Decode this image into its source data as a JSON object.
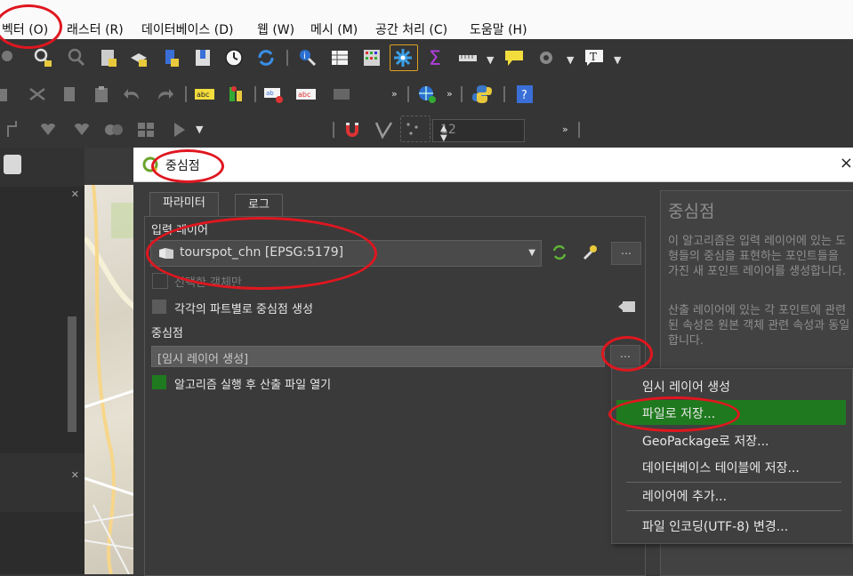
{
  "menubar": {
    "items": [
      "벡터 (O)",
      "래스터 (R)",
      "데이터베이스 (D)",
      "웹 (W)",
      "메시 (M)",
      "공간 처리 (C)",
      "도움말 (H)"
    ]
  },
  "toolbar": {
    "snap_tolerance": "12"
  },
  "dialog": {
    "title": "중심점",
    "close": "×",
    "tabs": [
      "파라미터",
      "로그"
    ],
    "input_layer_label": "입력 레이어",
    "input_layer_value": "tourspot_chn [EPSG:5179]",
    "selected_only_label": "선택한 객체만",
    "per_part_label": "각각의 파트별로 중심점 생성",
    "output_label": "중심점",
    "output_value": "[임시 레이어 생성]",
    "open_after_label": "알고리즘 실행 후 산출 파일 열기",
    "more_button": "…"
  },
  "help": {
    "heading": "중심점",
    "para1": "이 알고리즘은 입력 레이어에 있는 도형들의 중심을 표현하는 포인트들을 가진 새 포인트 레이어를 생성합니다.",
    "para2": "산출 레이어에 있는 각 포인트에 관련된 속성은 원본 객체 관련 속성과 동일합니다."
  },
  "output_menu": {
    "items": [
      "임시 레이어 생성",
      "파일로 저장...",
      "GeoPackage로 저장...",
      "데이터베이스 테이블에 저장...",
      "레이어에 추가...",
      "파일 인코딩(UTF-8) 변경..."
    ],
    "highlighted_index": 1,
    "highlight_color": "#1f7a1f"
  },
  "annotation_color": "#e0161f"
}
